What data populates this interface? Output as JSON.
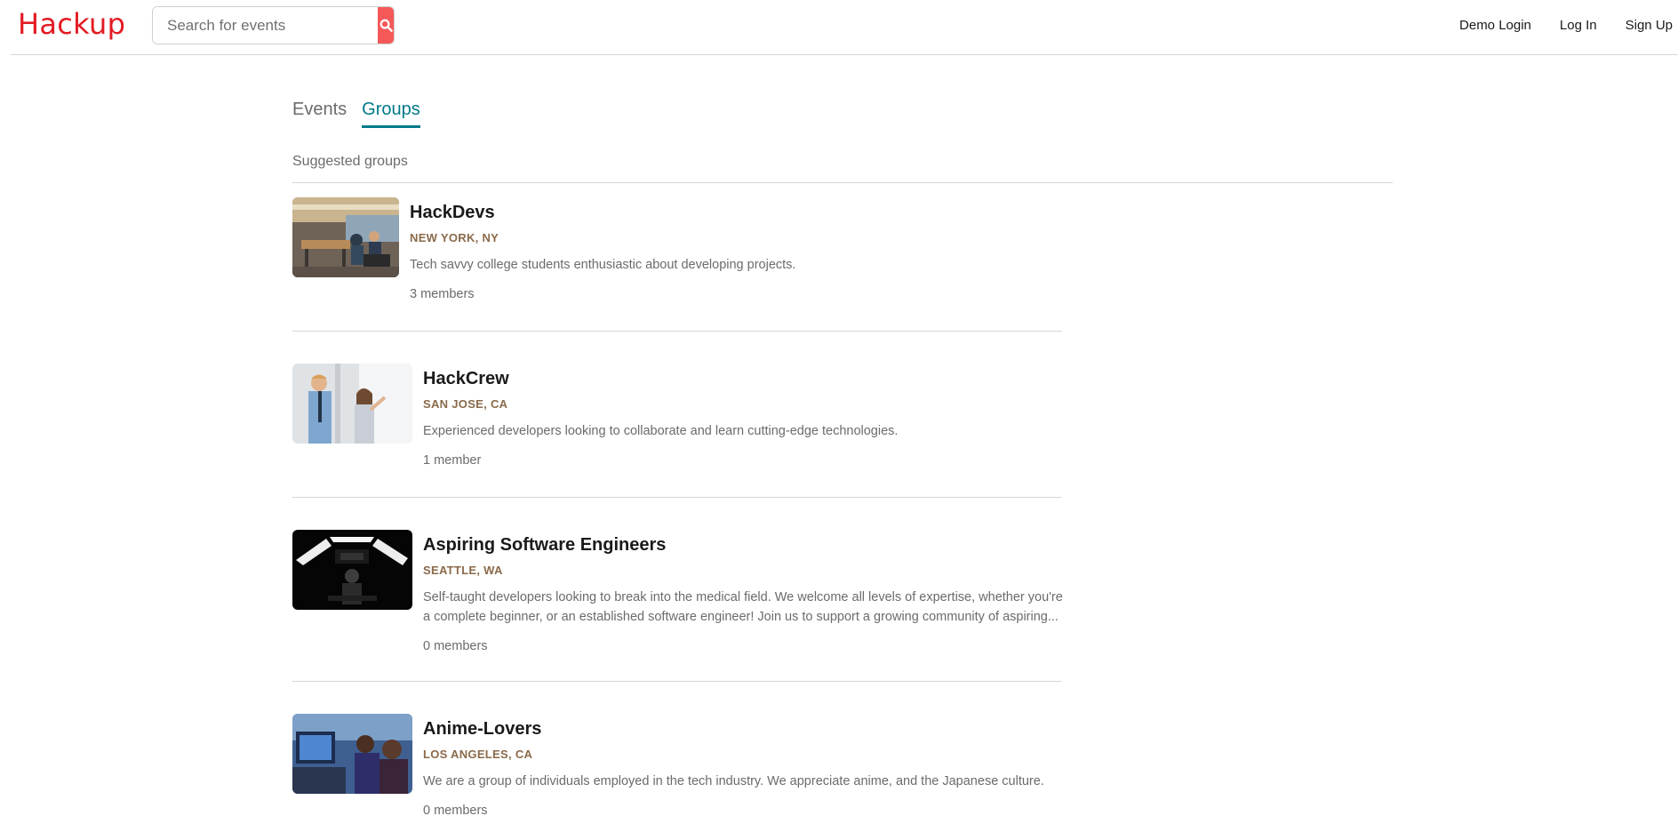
{
  "header": {
    "logo": "Hackup",
    "search": {
      "placeholder": "Search for events",
      "value": ""
    },
    "nav": {
      "demo_login": "Demo Login",
      "log_in": "Log In",
      "sign_up": "Sign Up"
    }
  },
  "tabs": [
    {
      "label": "Events",
      "active": false
    },
    {
      "label": "Groups",
      "active": true
    }
  ],
  "section_label": "Suggested groups",
  "groups": [
    {
      "name": "HackDevs",
      "location": "NEW YORK, NY",
      "description": "Tech savvy college students enthusiastic about developing projects.",
      "members": "3 members"
    },
    {
      "name": "HackCrew",
      "location": "SAN JOSE, CA",
      "description": "Experienced developers looking to collaborate and learn cutting-edge technologies.",
      "members": "1 member"
    },
    {
      "name": "Aspiring Software Engineers",
      "location": "SEATTLE, WA",
      "description": "Self-taught developers looking to break into the medical field. We welcome all levels of expertise, whether you're a complete beginner, or an established software engineer! Join us to support a growing community of aspiring...",
      "members": "0 members"
    },
    {
      "name": "Anime-Lovers",
      "location": "LOS ANGELES, CA",
      "description": "We are a group of individuals employed in the tech industry. We appreciate anime, and the Japanese culture.",
      "members": "0 members"
    }
  ],
  "colors": {
    "brand": "#e31b23",
    "search_button": "#f65858",
    "accent": "#00798a",
    "location": "#8a6a4a"
  }
}
